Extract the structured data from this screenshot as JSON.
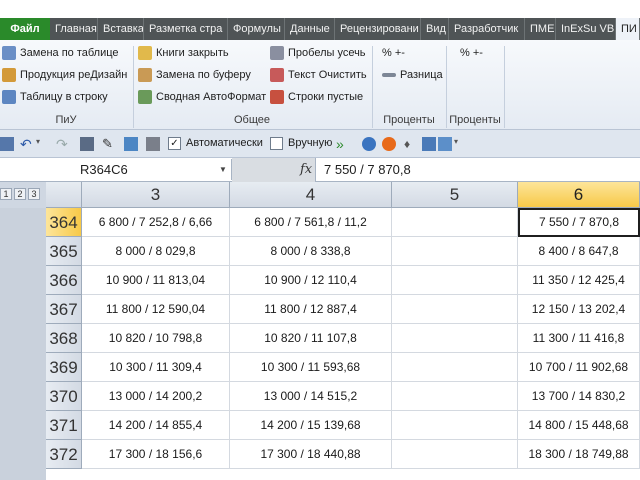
{
  "ribbon_tabs": [
    "Файл",
    "Главная",
    "Вставка",
    "Разметка стра",
    "Формулы",
    "Данные",
    "Рецензировани",
    "Вид",
    "Разработчик",
    "ПМЕ",
    "InExSu VBE",
    "ПИ"
  ],
  "ribbon": {
    "piu": [
      "Замена по таблице",
      "Продукция реДизайн",
      "Таблицу в строку"
    ],
    "piu_label": "ПиУ",
    "general_col1": [
      "Книги закрыть",
      "Замена по буферу",
      "Сводная АвтоФормат"
    ],
    "general_col2": [
      "Пробелы усечь",
      "Текст Очистить",
      "Строки пустые"
    ],
    "general_label": "Общее",
    "percent1": [
      "%  +-",
      "Разница"
    ],
    "percent1_label": "Проценты",
    "percent2": [
      "%  +-"
    ],
    "percent2_label": "Проценты"
  },
  "qat": {
    "auto_label": "Автоматически",
    "manual_label": "Вручную"
  },
  "formula_bar": {
    "name_box": "R364C6",
    "fx": "fx",
    "value": "7 550 / 7 870,8"
  },
  "outline_levels": [
    "1",
    "2",
    "3"
  ],
  "columns": [
    "3",
    "4",
    "5",
    "6"
  ],
  "rows": [
    {
      "num": "364",
      "c3": "6 800 / 7 252,8 / 6,66",
      "c4": "6 800 / 7 561,8 / 11,2",
      "c5": "",
      "c6": "7 550 / 7 870,8"
    },
    {
      "num": "365",
      "c3": "8 000 / 8 029,8",
      "c4": "8 000 / 8 338,8",
      "c5": "",
      "c6": "8 400 / 8 647,8"
    },
    {
      "num": "366",
      "c3": "10 900 / 11 813,04",
      "c4": "10 900 / 12 110,4",
      "c5": "",
      "c6": "11 350 / 12 425,4"
    },
    {
      "num": "367",
      "c3": "11 800 / 12 590,04",
      "c4": "11 800 / 12 887,4",
      "c5": "",
      "c6": "12 150 / 13 202,4"
    },
    {
      "num": "368",
      "c3": "10 820 / 10 798,8",
      "c4": "10 820 / 11 107,8",
      "c5": "",
      "c6": "11 300 / 11 416,8"
    },
    {
      "num": "369",
      "c3": "10 300 / 11 309,4",
      "c4": "10 300 / 11 593,68",
      "c5": "",
      "c6": "10 700 / 11 902,68"
    },
    {
      "num": "370",
      "c3": "13 000 / 14 200,2",
      "c4": "13 000 / 14 515,2",
      "c5": "",
      "c6": "13 700 / 14 830,2"
    },
    {
      "num": "371",
      "c3": "14 200 / 14 855,4",
      "c4": "14 200 / 15 139,68",
      "c5": "",
      "c6": "14 800 / 15 448,68"
    },
    {
      "num": "372",
      "c3": "17 300 / 18 156,6",
      "c4": "17 300 / 18 440,88",
      "c5": "",
      "c6": "18 300 / 18 749,88"
    }
  ],
  "colors": {
    "file_tab": "#2a8a2a",
    "tab_bar": "#4f5456",
    "selection_header": "#f7c948"
  }
}
